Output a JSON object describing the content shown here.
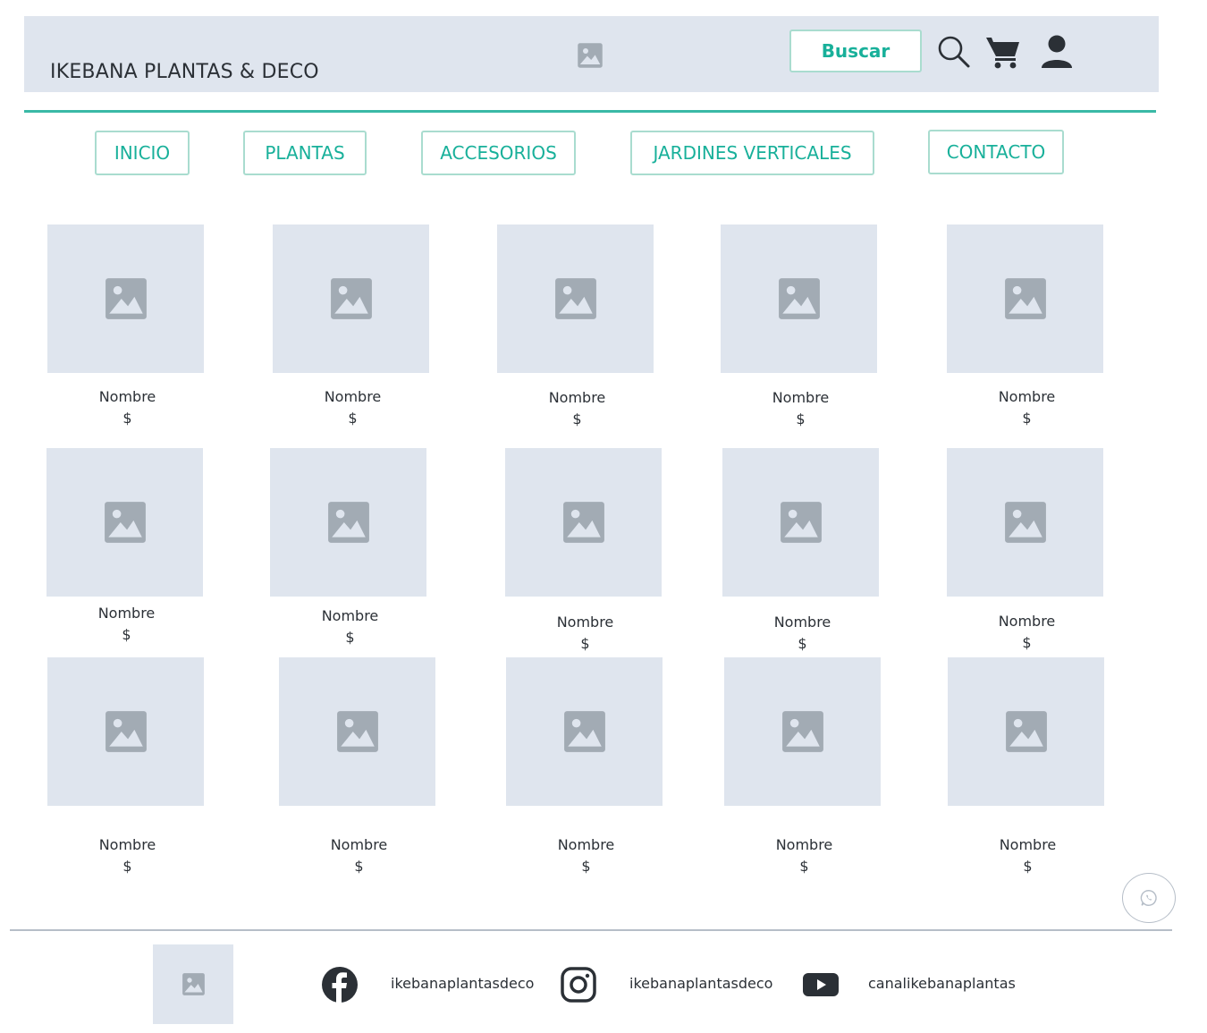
{
  "header": {
    "brand": "IKEBANA PLANTAS & DECO",
    "logo_icon": "image-placeholder-icon",
    "search_label": "Buscar",
    "icons": [
      "search-icon",
      "cart-icon",
      "user-icon"
    ]
  },
  "nav": [
    {
      "label": "INICIO"
    },
    {
      "label": "PLANTAS"
    },
    {
      "label": "ACCESORIOS"
    },
    {
      "label": "JARDINES VERTICALES"
    },
    {
      "label": "CONTACTO"
    }
  ],
  "products": [
    {
      "name": "Nombre",
      "price": "$"
    },
    {
      "name": "Nombre",
      "price": "$"
    },
    {
      "name": "Nombre",
      "price": "$"
    },
    {
      "name": "Nombre",
      "price": "$"
    },
    {
      "name": "Nombre",
      "price": "$"
    },
    {
      "name": "Nombre",
      "price": "$"
    },
    {
      "name": "Nombre",
      "price": "$"
    },
    {
      "name": "Nombre",
      "price": "$"
    },
    {
      "name": "Nombre",
      "price": "$"
    },
    {
      "name": "Nombre",
      "price": "$"
    },
    {
      "name": "Nombre",
      "price": "$"
    },
    {
      "name": "Nombre",
      "price": "$"
    },
    {
      "name": "Nombre",
      "price": "$"
    },
    {
      "name": "Nombre",
      "price": "$"
    },
    {
      "name": "Nombre",
      "price": "$"
    }
  ],
  "footer": {
    "facebook": "ikebanaplantasdeco",
    "instagram": "ikebanaplantasdeco",
    "youtube": "canalikebanaplantas"
  },
  "colors": {
    "accent": "#18b09a",
    "placeholder_bg": "#dfe5ee",
    "placeholder_icon": "#a2abb4",
    "text": "#2b3036"
  }
}
